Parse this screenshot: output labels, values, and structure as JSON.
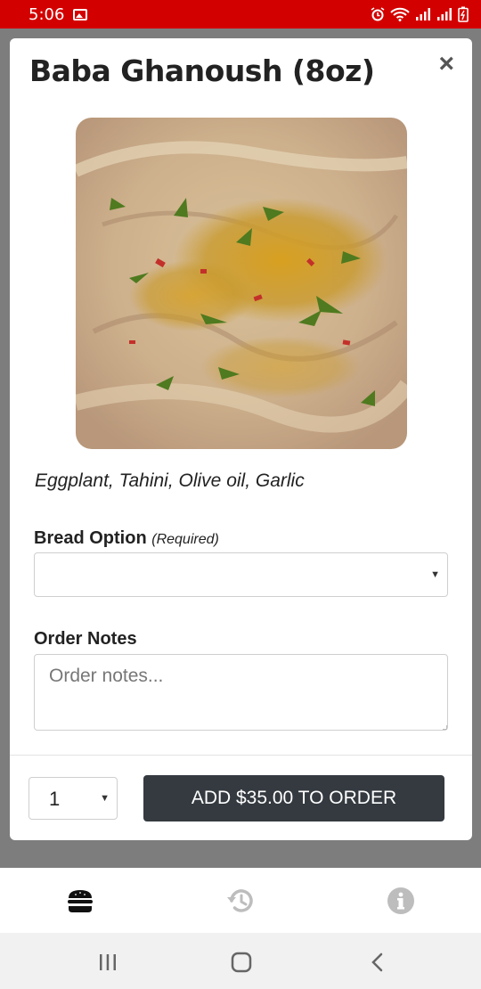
{
  "status_bar": {
    "time": "5:06",
    "icons": [
      "image-icon",
      "alarm-icon",
      "wifi-icon",
      "signal-icon",
      "signal-icon",
      "battery-icon"
    ]
  },
  "modal": {
    "title": "Baba Ghanoush (8oz)",
    "close_glyph": "×",
    "description": "Eggplant, Tahini, Olive oil, Garlic",
    "bread_option": {
      "label": "Bread Option",
      "required_note": "(Required)",
      "selected_value": ""
    },
    "order_notes": {
      "label": "Order Notes",
      "placeholder": "Order notes..."
    },
    "quantity": {
      "selected_value": "1"
    },
    "add_button_label": "ADD $35.00 TO ORDER"
  },
  "tabbar": {
    "tabs": [
      {
        "icon": "burger-icon",
        "active": true
      },
      {
        "icon": "history-icon",
        "active": false
      },
      {
        "icon": "info-icon",
        "active": false
      }
    ]
  },
  "colors": {
    "status_bar": "#d30000",
    "primary_button": "#343a40",
    "backdrop": "#7d7d7d",
    "inactive_tab": "#bdbdbd"
  }
}
